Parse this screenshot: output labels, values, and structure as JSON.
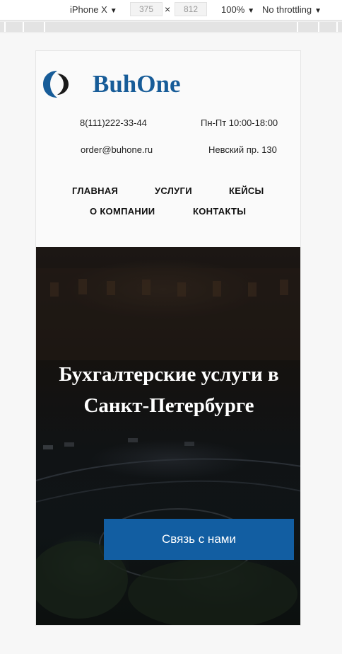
{
  "devtools": {
    "device": "iPhone X",
    "width": "375",
    "separator": "×",
    "height": "812",
    "zoom": "100%",
    "throttling": "No throttling",
    "caret": "▼"
  },
  "site": {
    "logo_text": "BuhOne",
    "brand_color": "#175c98",
    "contacts": {
      "phone": "8(111)222-33-44",
      "hours": "Пн-Пт 10:00-18:00",
      "email": "order@buhone.ru",
      "address": "Невский пр. 130"
    },
    "nav": {
      "home": "ГЛАВНАЯ",
      "services": "УСЛУГИ",
      "cases": "КЕЙСЫ",
      "about": "О КОМПАНИИ",
      "contacts": "КОНТАКТЫ"
    },
    "hero": {
      "title_line1": "Бухгалтерские услуги в",
      "title_line2": "Санкт-Петербурге",
      "cta_label": "Связь с нами",
      "cta_color": "#125ea2"
    }
  }
}
